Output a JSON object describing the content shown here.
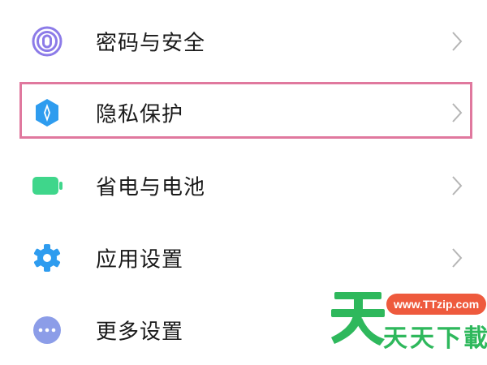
{
  "settings": {
    "items": [
      {
        "label": "密码与安全",
        "icon": "fingerprint-icon",
        "color": "#8c7be8"
      },
      {
        "label": "隐私保护",
        "icon": "shield-icon",
        "color": "#2e9cef"
      },
      {
        "label": "省电与电池",
        "icon": "battery-icon",
        "color": "#3fd68b"
      },
      {
        "label": "应用设置",
        "icon": "gear-icon",
        "color": "#2e9cef"
      },
      {
        "label": "更多设置",
        "icon": "more-dots-icon",
        "color": "#8c9de8"
      }
    ],
    "highlight_color": "#e0789e"
  },
  "watermark": {
    "url": "www.TTzip.com",
    "text": "天天下載",
    "green": "#2eb85c",
    "orange": "#ee5a3d"
  }
}
